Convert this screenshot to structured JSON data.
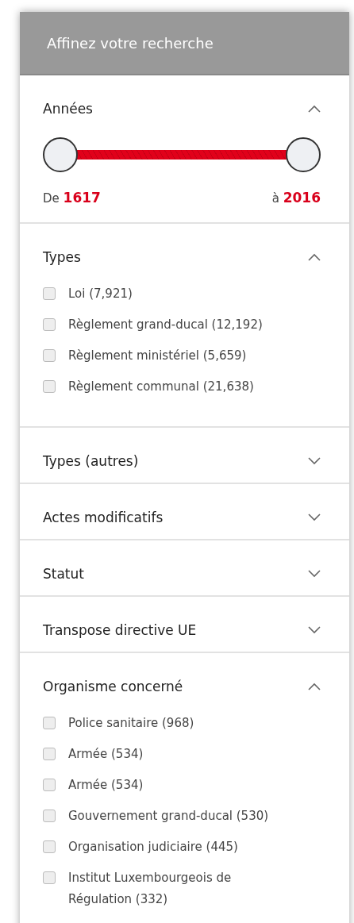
{
  "panel": {
    "title": "Affinez votre recherche"
  },
  "sections": [
    {
      "kind": "range",
      "title": "Années",
      "expanded": true,
      "slider": {
        "level": 1
      },
      "from_label": "De",
      "from_value": "1617",
      "to_label": "à",
      "to_value": "2016"
    },
    {
      "kind": "checklist",
      "title": "Types",
      "expanded": true,
      "items": [
        {
          "label": "Loi (7,921)",
          "checked": false
        },
        {
          "label": "Règlement grand-ducal (12,192)",
          "checked": false
        },
        {
          "label": "Règlement ministériel (5,659)",
          "checked": false
        },
        {
          "label": "Règlement communal (21,638)",
          "checked": false
        }
      ]
    },
    {
      "title": "Types (autres)",
      "expanded": false
    },
    {
      "title": "Actes modificatifs",
      "expanded": false
    },
    {
      "title": "Statut",
      "expanded": false
    },
    {
      "title": "Transpose directive UE",
      "expanded": false
    },
    {
      "kind": "checklist",
      "title": "Organisme concerné",
      "expanded": true,
      "items": [
        {
          "label": "Police sanitaire (968)",
          "checked": false
        },
        {
          "label": "Armée (534)",
          "checked": false
        },
        {
          "label": "Armée (534)",
          "checked": false
        },
        {
          "label": "Gouvernement grand-ducal (530)",
          "checked": false
        },
        {
          "label": "Organisation judiciaire (445)",
          "checked": false
        },
        {
          "label": "Institut Luxembourgeois de Régulation (332)",
          "checked": false
        }
      ]
    }
  ]
}
